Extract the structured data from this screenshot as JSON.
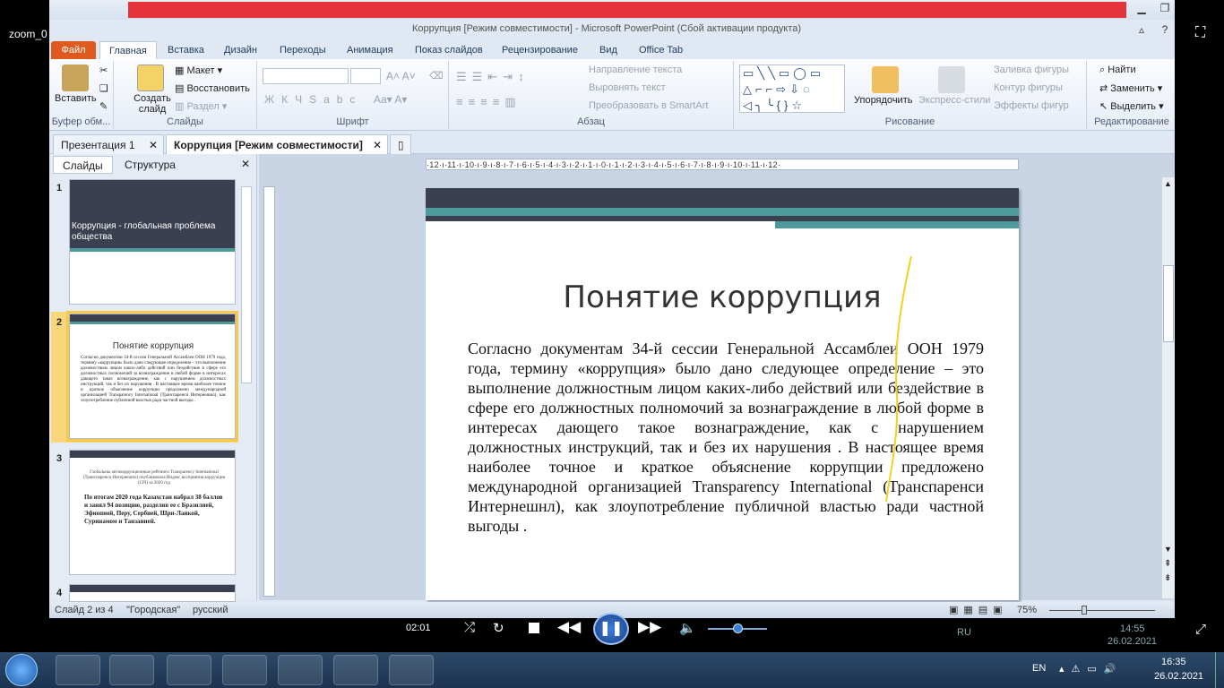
{
  "zoom": {
    "label": "zoom_0",
    "elapsed": "02:01"
  },
  "window": {
    "title": "Коррупция [Режим совместимости] - Microsoft PowerPoint (Сбой активации продукта)"
  },
  "ribbon_tabs": [
    "Файл",
    "Главная",
    "Вставка",
    "Дизайн",
    "Переходы",
    "Анимация",
    "Показ слайдов",
    "Рецензирование",
    "Вид",
    "Office Tab"
  ],
  "ribbon": {
    "clipboard": {
      "paste": "Вставить",
      "label": "Буфер обм..."
    },
    "slides": {
      "create": "Создать слайд",
      "layout": "Макет",
      "reset": "Восстановить",
      "section": "Раздел",
      "label": "Слайды"
    },
    "font": {
      "label": "Шрифт"
    },
    "paragraph": {
      "direction": "Направление текста",
      "align": "Выровнять текст",
      "smartart": "Преобразовать в SmartArt",
      "label": "Абзац"
    },
    "drawing": {
      "arrange": "Упорядочить",
      "styles": "Экспресс-стили",
      "fill": "Заливка фигуры",
      "outline": "Контур фигуры",
      "effects": "Эффекты фигур",
      "label": "Рисование"
    },
    "editing": {
      "find": "Найти",
      "replace": "Заменить",
      "select": "Выделить",
      "label": "Редактирование"
    }
  },
  "doc_tabs": [
    "Презентация 1",
    "Коррупция [Режим совместимости]"
  ],
  "panel_tabs": [
    "Слайды",
    "Структура"
  ],
  "thumbnails": [
    {
      "num": "1",
      "title": "Коррупция - глобальная проблема общества"
    },
    {
      "num": "2",
      "title": "Понятие коррупция"
    },
    {
      "num": "3",
      "heading": "Глобальны антикоррупционные рейтинги Transparency International (Транспаренси Интернешнл) опубликовала Индекс восприятия коррупции (CPI) за 2020 год",
      "bullet": "По итогам 2020 года Казахстан набрал 38 баллов и занял 94 позицию, разделив ее с Бразилией, Эфиопией, Перу, Сербией, Шри-Ланкой, Суринамом и Танзанией."
    },
    {
      "num": "4"
    }
  ],
  "ruler": "·12·ı·11·ı·10·ı·9·ı·8·ı·7·ı·6·ı·5·ı·4·ı·3·ı·2·ı·1·ı·0·ı·1·ı·2·ı·3·ı·4·ı·5·ı·6·ı·7·ı·8·ı·9·ı·10·ı·11·ı·12·",
  "slide": {
    "title": "Понятие коррупция",
    "body": "Согласно документам 34-й сессии Генеральной Ассамблеи ООН 1979 года, термину «коррупция» было дано следующее определение – это выполнение должностным лицом каких-либо действий или бездействие в сфере его должностных полномочий за вознаграждение в любой форме в интересах дающего такое вознаграждение, как с нарушением должностных инструкций, так и без их нарушения . В настоящее время наиболее точное и краткое объяснение коррупции предложено международной организацией Transparency International (Транспаренси Интернешнл), как злоупотребление публичной властью ради частной выгоды ."
  },
  "status": {
    "slide": "Слайд 2 из 4",
    "theme": "\"Городская\"",
    "lang": "русский",
    "zoom": "75%"
  },
  "taskbar": {
    "lang": "EN",
    "time": "16:35",
    "date": "26.02.2021",
    "ghost_time": "14:55",
    "ghost_date": "26.02.2021",
    "ghost_lang": "RU"
  },
  "colors": {
    "accent": "#4d9a9d",
    "dark": "#3b4050",
    "file_tab": "#e05a20"
  }
}
